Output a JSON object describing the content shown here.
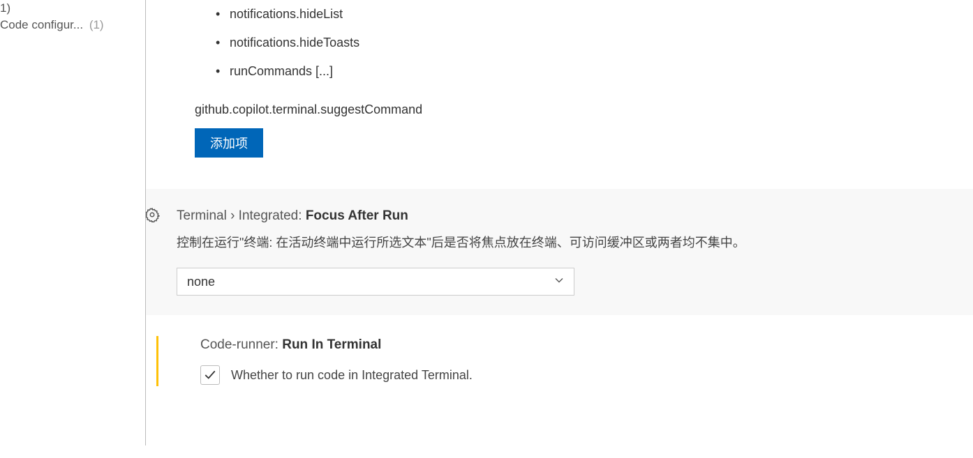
{
  "sidebar": {
    "items": [
      {
        "label": "1)",
        "count": ""
      },
      {
        "label": "Code configur...",
        "count": "(1)"
      }
    ]
  },
  "commands": {
    "items": [
      "notifications.hideList",
      "notifications.hideToasts",
      "runCommands [...]"
    ],
    "entry": "github.copilot.terminal.suggestCommand",
    "add_button": "添加项"
  },
  "focusAfterRun": {
    "category": "Terminal › Integrated: ",
    "name": "Focus After Run",
    "description": "控制在运行\"终端: 在活动终端中运行所选文本\"后是否将焦点放在终端、可访问缓冲区或两者均不集中。",
    "value": "none"
  },
  "codeRunner": {
    "category": "Code-runner: ",
    "name": "Run In Terminal",
    "label": "Whether to run code in Integrated Terminal.",
    "checked": true
  }
}
